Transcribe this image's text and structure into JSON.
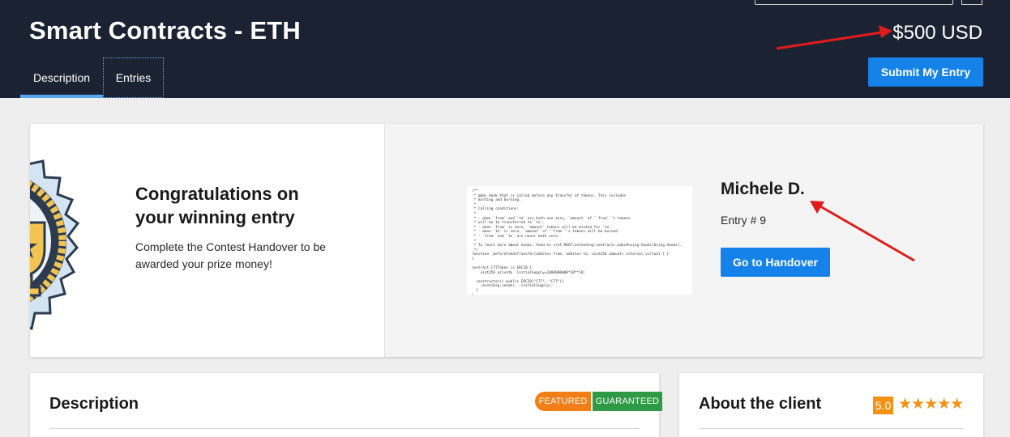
{
  "header": {
    "title": "Smart Contracts - ETH",
    "price": "$500 USD",
    "submit_label": "Submit My Entry",
    "tabs": [
      {
        "label": "Description"
      },
      {
        "label": "Entries"
      }
    ]
  },
  "winner": {
    "heading": "Congratulations on your winning entry",
    "subtext": "Complete the Contest Handover to be awarded your prize money!",
    "name": "Michele D.",
    "entry": "Entry # 9",
    "handover_label": "Go to Handover",
    "code_lines": [
      "/**",
      " * @dev Hook that is called before any transfer of tokens. This includes",
      " * minting and burning.",
      " *",
      " * Calling conditions:",
      " *",
      " * - when `from` and `to` are both non-zero, `amount` of ``from``'s tokens",
      " * will be to transferred to `to`.",
      " * - when `from` is zero, `amount` tokens will be minted for `to`.",
      " * - when `to` is zero, `amount` of ``from``'s tokens will be burned.",
      " * - `from` and `to` are never both zero.",
      " *",
      " * To learn more about hooks, head to xref:ROOT:extending-contracts.adoc#using-hooks[Using Hooks].",
      " */",
      "function _beforeTokenTransfer(address from, address to, uint256 amount) internal virtual { }",
      "}",
      "",
      "contract C77Token is ERC20 {",
      "    uint256 private _initialSupply=1000000000*10**18;",
      "",
      "  constructor() public ERC20(\"C77\", \"C77\"){",
      "    _mint(msg.sender, _initialSupply);",
      "  }",
      "}"
    ]
  },
  "description": {
    "title": "Description",
    "badge_featured": "FEATURED",
    "badge_guaranteed": "GUARANTEED"
  },
  "client": {
    "title": "About the client",
    "rating": "5.0",
    "stars": "★★★★★"
  },
  "colors": {
    "header_bg": "#1b2232",
    "primary_button": "#1582ea",
    "featured": "#f27e17",
    "guaranteed": "#2f9a45",
    "rating": "#f39214",
    "annotation_arrow": "#e01b1b"
  },
  "icons": [
    "medal-icon",
    "trophy-icon",
    "star-icon",
    "arrow-annotation"
  ]
}
